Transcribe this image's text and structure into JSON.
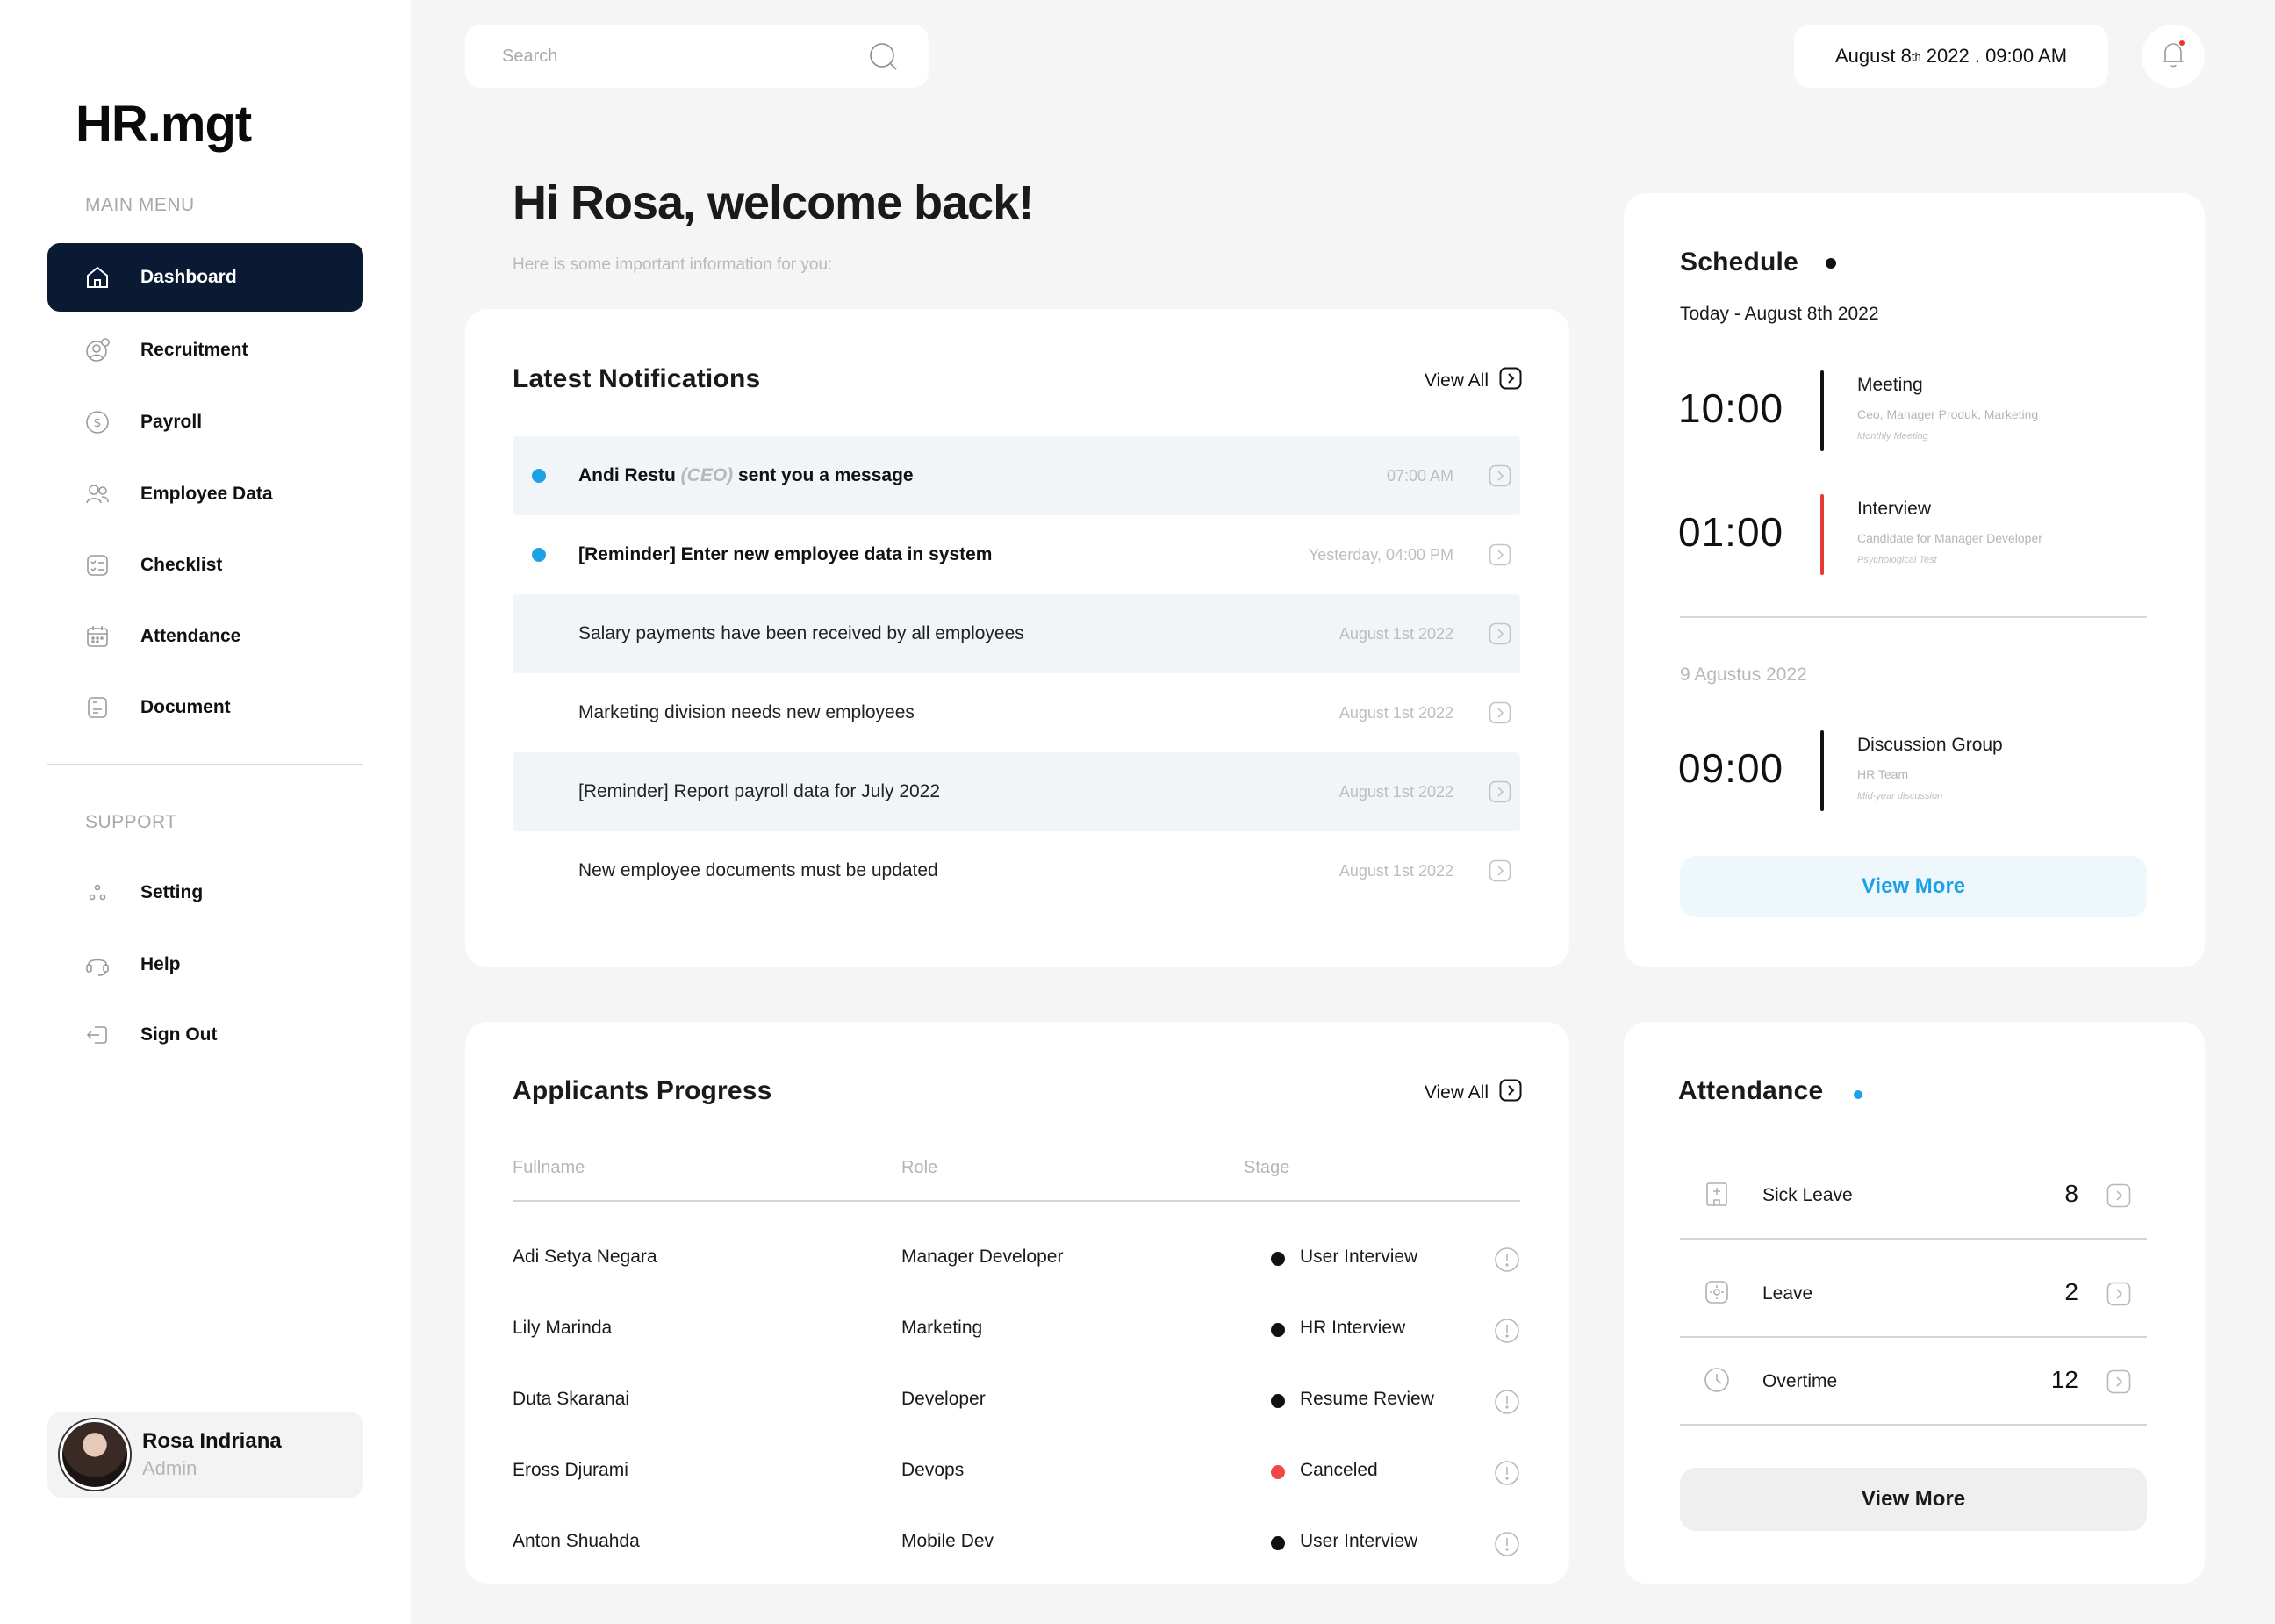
{
  "app": {
    "logo": "HR.mgt"
  },
  "sidebar": {
    "main_caption": "MAIN MENU",
    "support_caption": "SUPPORT",
    "items": [
      {
        "label": "Dashboard",
        "icon": "home-icon",
        "active": true
      },
      {
        "label": "Recruitment",
        "icon": "recruitment-icon"
      },
      {
        "label": "Payroll",
        "icon": "dollar-icon"
      },
      {
        "label": "Employee Data",
        "icon": "users-icon"
      },
      {
        "label": "Checklist",
        "icon": "checklist-icon"
      },
      {
        "label": "Attendance",
        "icon": "calendar-icon"
      },
      {
        "label": "Document",
        "icon": "document-icon"
      }
    ],
    "support_items": [
      {
        "label": "Setting",
        "icon": "settings-icon"
      },
      {
        "label": "Help",
        "icon": "headset-icon"
      },
      {
        "label": "Sign Out",
        "icon": "sign-out-icon"
      }
    ],
    "profile": {
      "name": "Rosa Indriana",
      "role": "Admin"
    }
  },
  "header": {
    "search_placeholder": "Search",
    "date_main": "August 8",
    "date_sup": "th",
    "date_rest": " 2022 . 09:00 AM"
  },
  "welcome": {
    "title": "Hi Rosa, welcome back!",
    "subtitle": "Here is some important information for you:"
  },
  "notifications": {
    "title": "Latest Notifications",
    "view_all": "View All",
    "items": [
      {
        "pre": "Andi Restu ",
        "ceo": "(CEO)",
        "post": " sent you a message",
        "time": "07:00 AM",
        "unread": true
      },
      {
        "pre": "[Reminder] Enter new employee data in system",
        "ceo": "",
        "post": "",
        "time": "Yesterday, 04:00 PM",
        "unread": true
      },
      {
        "pre": "Salary payments have been received by all employees",
        "ceo": "",
        "post": "",
        "time": "August 1st 2022",
        "unread": false
      },
      {
        "pre": "Marketing division needs new employees",
        "ceo": "",
        "post": "",
        "time": "August 1st 2022",
        "unread": false
      },
      {
        "pre": "[Reminder] Report payroll data for July 2022",
        "ceo": "",
        "post": "",
        "time": "August 1st 2022",
        "unread": false
      },
      {
        "pre": "New employee documents must be updated",
        "ceo": "",
        "post": "",
        "time": "August 1st 2022",
        "unread": false
      }
    ]
  },
  "applicants": {
    "title": "Applicants Progress",
    "view_all": "View All",
    "columns": [
      "Fullname",
      "Role",
      "Stage"
    ],
    "rows": [
      {
        "name": "Adi Setya Negara",
        "role": "Manager Developer",
        "stage": "User Interview",
        "stage_color": "#111111"
      },
      {
        "name": "Lily Marinda",
        "role": "Marketing",
        "stage": "HR Interview",
        "stage_color": "#111111"
      },
      {
        "name": "Duta Skaranai",
        "role": "Developer",
        "stage": "Resume Review",
        "stage_color": "#111111"
      },
      {
        "name": "Eross Djurami",
        "role": "Devops",
        "stage": "Canceled",
        "stage_color": "#f04747"
      },
      {
        "name": "Anton Shuahda",
        "role": "Mobile Dev",
        "stage": "User Interview",
        "stage_color": "#111111"
      }
    ]
  },
  "schedule": {
    "title": "Schedule",
    "today_label": "Today - August 8th 2022",
    "other_label": "9 Agustus 2022",
    "events": [
      {
        "time": "10:00",
        "title": "Meeting",
        "sub": "Ceo, Manager Produk, Marketing",
        "note": "Monthly Meeting",
        "bar": "#111111"
      },
      {
        "time": "01:00",
        "title": "Interview",
        "sub": "Candidate for Manager Developer",
        "note": "Psychological Test",
        "bar": "#e53935"
      },
      {
        "time": "09:00",
        "title": "Discussion Group",
        "sub": "HR Team",
        "note": "Mid-year discussion",
        "bar": "#111111"
      }
    ],
    "view_more": "View More"
  },
  "attendance": {
    "title": "Attendance",
    "rows": [
      {
        "label": "Sick Leave",
        "value": "8",
        "icon": "hospital-icon"
      },
      {
        "label": "Leave",
        "value": "2",
        "icon": "leave-icon"
      },
      {
        "label": "Overtime",
        "value": "12",
        "icon": "clock-icon"
      }
    ],
    "view_more": "View More"
  },
  "colors": {
    "primary": "#0b1a33",
    "accent": "#1da1e6",
    "danger": "#e53935",
    "background": "#f5f5f5"
  }
}
